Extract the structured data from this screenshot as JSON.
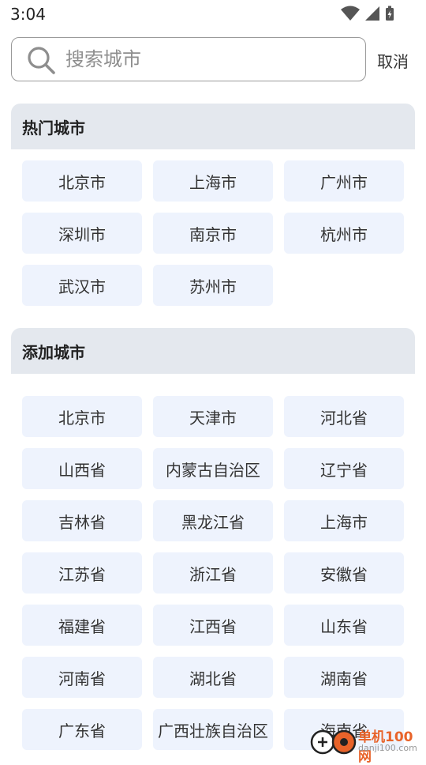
{
  "status_bar": {
    "time": "3:04",
    "icons": [
      "wifi-icon",
      "cell-signal-icon",
      "battery-icon"
    ]
  },
  "search": {
    "placeholder": "搜索城市",
    "value": "",
    "cancel_label": "取消"
  },
  "hot_cities": {
    "title": "热门城市",
    "items": [
      "北京市",
      "上海市",
      "广州市",
      "深圳市",
      "南京市",
      "杭州市",
      "武汉市",
      "苏州市"
    ]
  },
  "add_cities": {
    "title": "添加城市",
    "items": [
      "北京市",
      "天津市",
      "河北省",
      "山西省",
      "内蒙古自治区",
      "辽宁省",
      "吉林省",
      "黑龙江省",
      "上海市",
      "江苏省",
      "浙江省",
      "安徽省",
      "福建省",
      "江西省",
      "山东省",
      "河南省",
      "湖北省",
      "湖南省",
      "广东省",
      "广西壮族自治区",
      "海南省"
    ]
  },
  "watermark": {
    "title": "单机100网",
    "url": "danji100.com"
  },
  "colors": {
    "chip_bg": "#eef3fd",
    "header_bg": "#e4e8ee",
    "watermark": "#e8632a"
  }
}
